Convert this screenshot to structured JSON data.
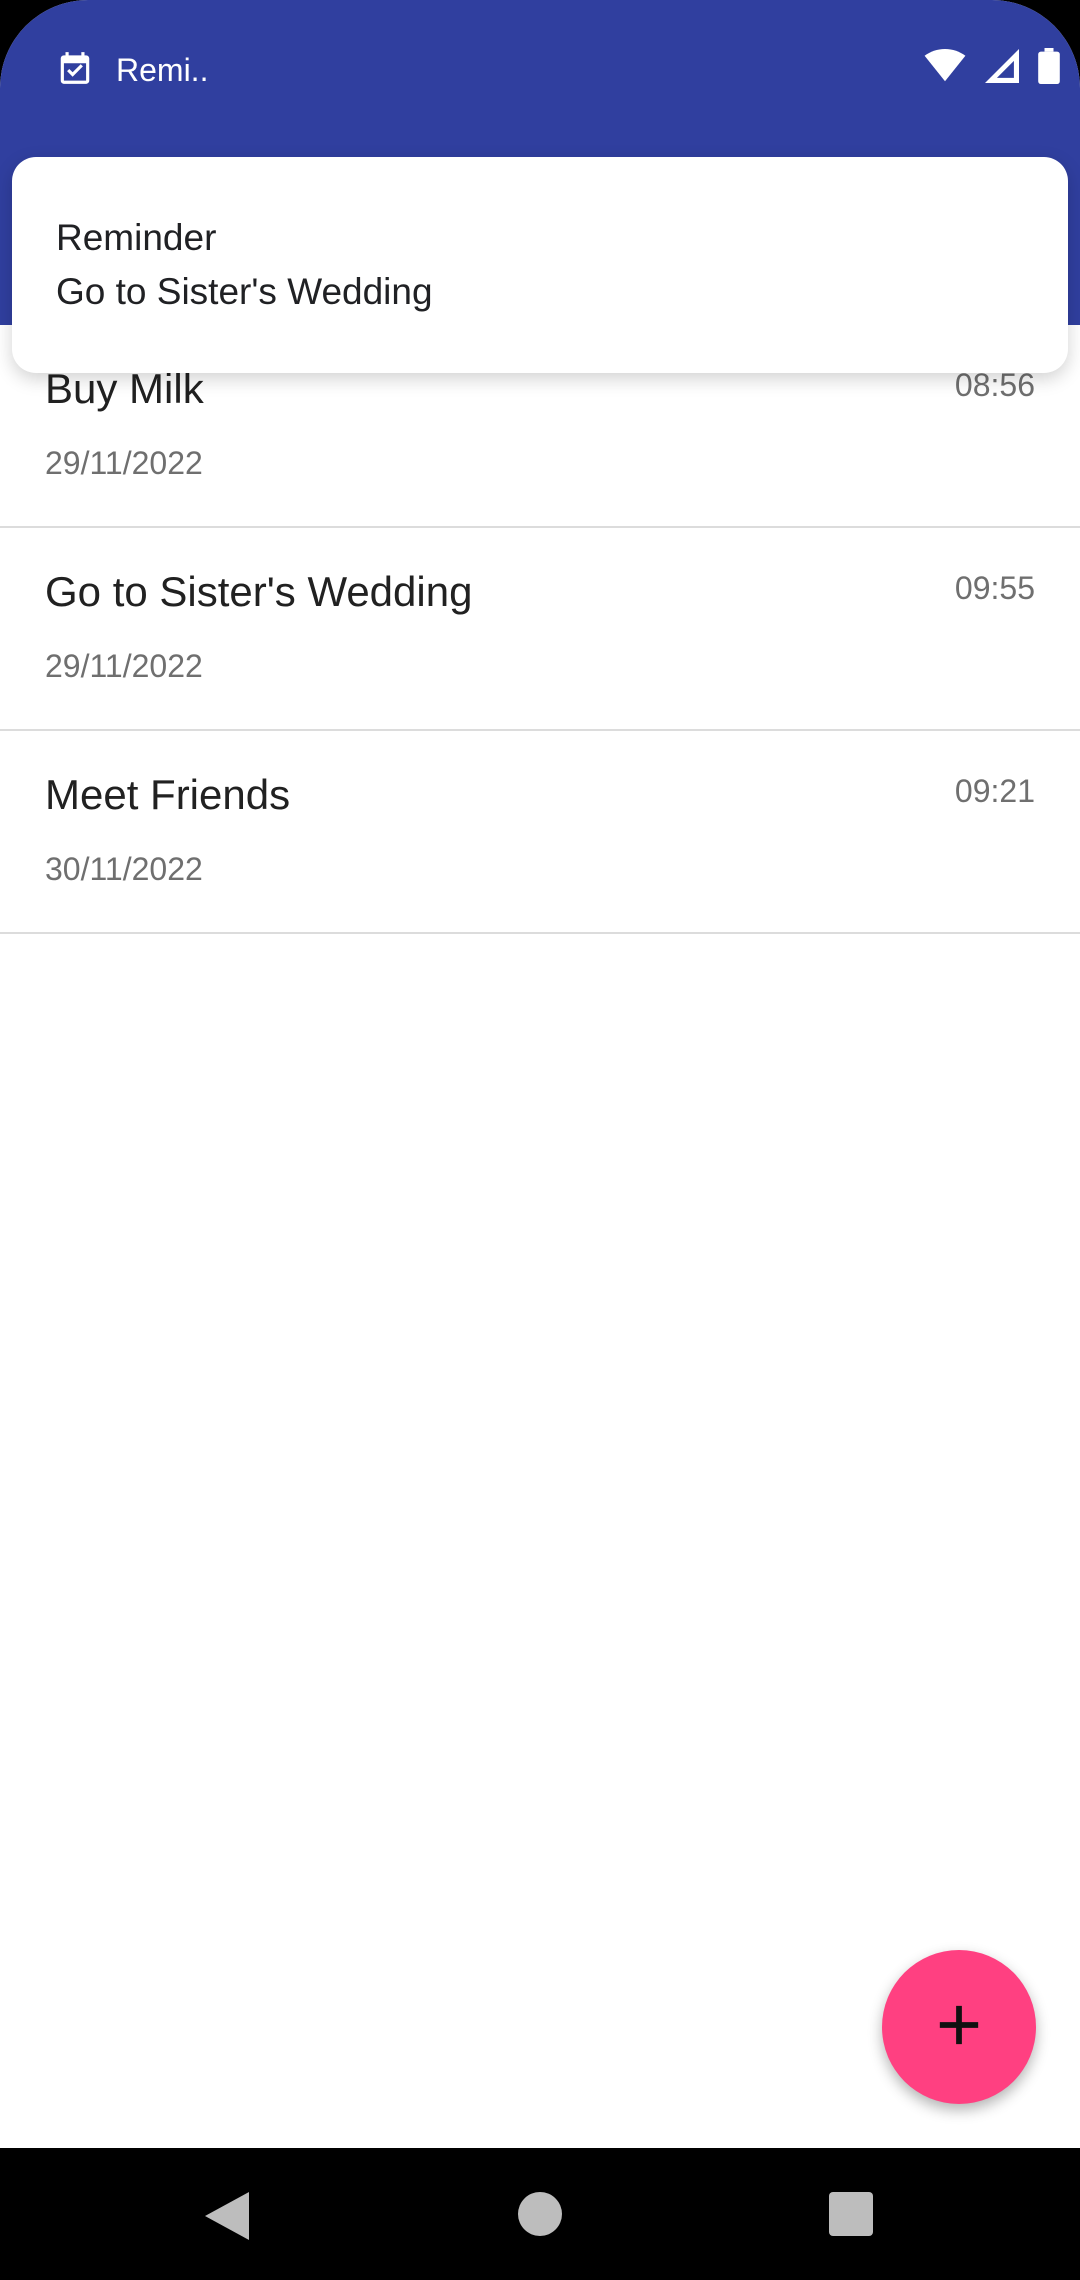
{
  "status_bar": {
    "app_name": "Remi..",
    "icons": [
      "calendar-check-icon",
      "wifi-icon",
      "signal-icon",
      "battery-icon"
    ]
  },
  "notification": {
    "title": "Reminder",
    "text": "Go to Sister's Wedding"
  },
  "reminders": [
    {
      "title": "Buy Milk",
      "date": "29/11/2022",
      "time": "08:56"
    },
    {
      "title": "Go to Sister's Wedding",
      "date": "29/11/2022",
      "time": "09:55"
    },
    {
      "title": "Meet Friends",
      "date": "30/11/2022",
      "time": "09:21"
    }
  ],
  "fab": {
    "icon": "plus-icon"
  },
  "colors": {
    "primary": "#303F9F",
    "accent": "#FF4081"
  },
  "nav": [
    "back-icon",
    "home-icon",
    "recents-icon"
  ]
}
